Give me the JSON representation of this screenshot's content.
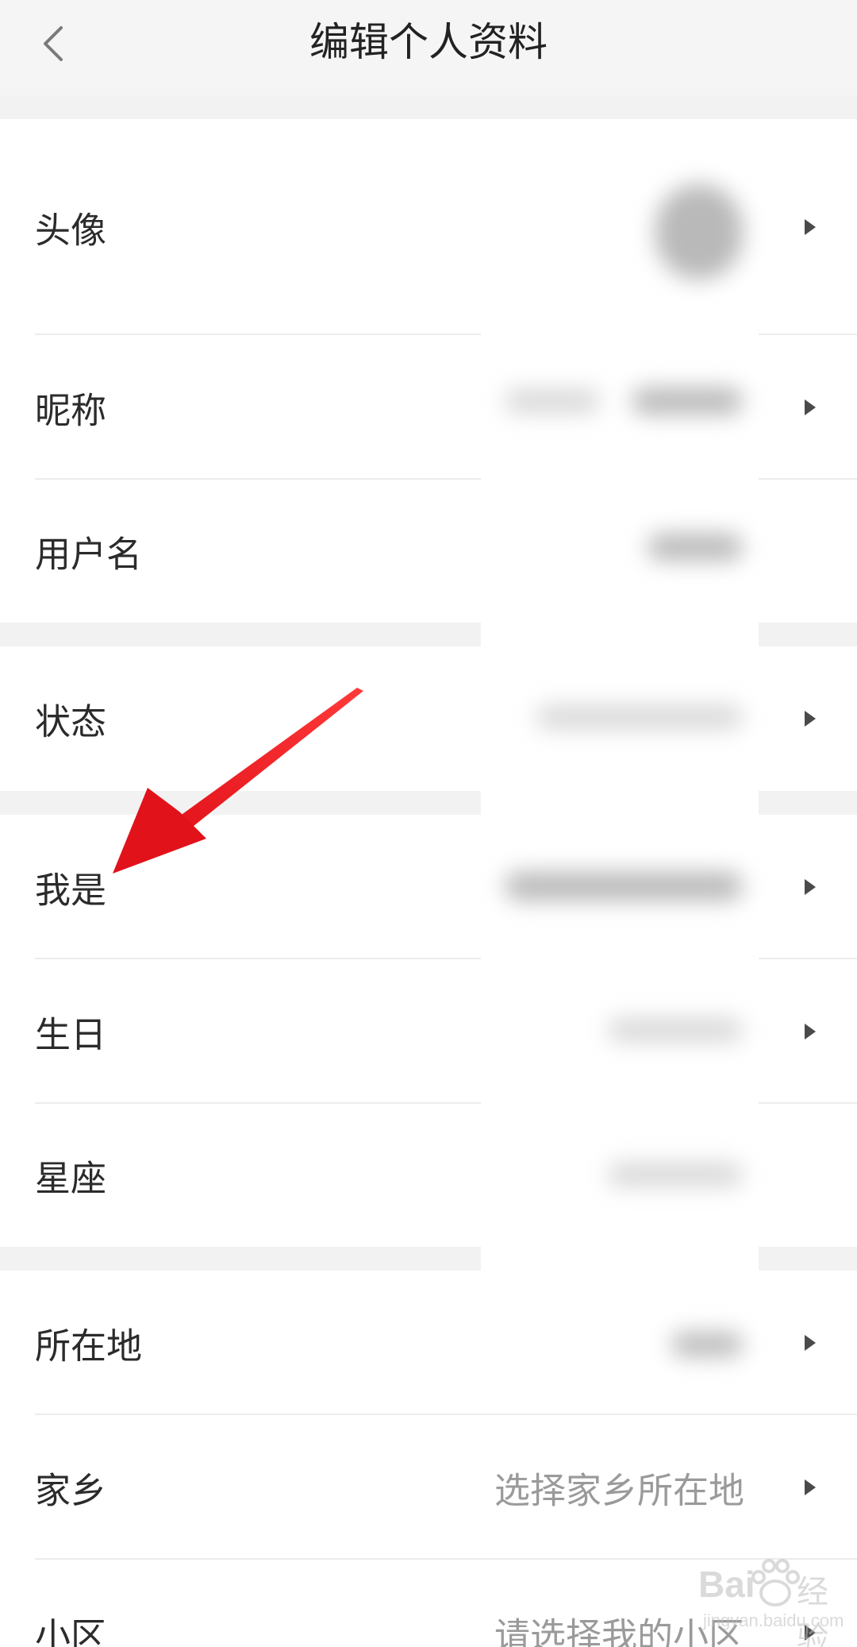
{
  "header": {
    "title": "编辑个人资料"
  },
  "rows": {
    "avatar": {
      "label": "头像"
    },
    "nickname": {
      "label": "昵称"
    },
    "username": {
      "label": "用户名"
    },
    "status": {
      "label": "状态"
    },
    "identity": {
      "label": "我是"
    },
    "birthday": {
      "label": "生日"
    },
    "zodiac": {
      "label": "星座"
    },
    "location": {
      "label": "所在地"
    },
    "hometown": {
      "label": "家乡",
      "value": "选择家乡所在地"
    },
    "community": {
      "label": "小区",
      "value": "请选择我的小区"
    }
  },
  "watermark": {
    "brand": "Bai",
    "brand_suffix": "经验",
    "url": "jingyan.baidu.com"
  },
  "colors": {
    "background": "#f2f2f2",
    "row_background": "#ffffff",
    "label": "#2b2b2b",
    "placeholder": "#9a9a9a",
    "arrow": "#e8141c"
  }
}
